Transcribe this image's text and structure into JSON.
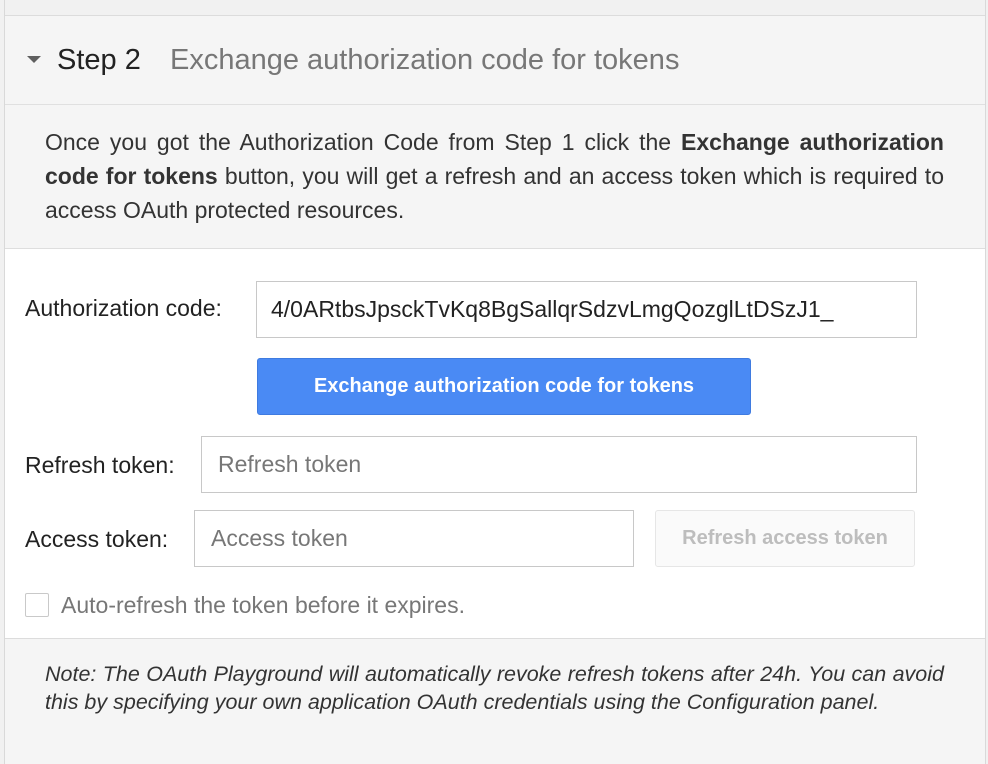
{
  "header": {
    "step_label": "Step 2",
    "step_title": "Exchange authorization code for tokens"
  },
  "description": {
    "text_before": "Once you got the Authorization Code from Step 1 click the ",
    "bold_text": "Exchange authorization code for tokens",
    "text_after": " button, you will get a refresh and an access token which is required to access OAuth protected resources."
  },
  "form": {
    "auth_code_label": "Authorization code:",
    "auth_code_value": "4/0ARtbsJpsckTvKq8BgSallqrSdzvLmgQozglLtDSzJ1_",
    "exchange_button_label": "Exchange authorization code for tokens",
    "refresh_token_label": "Refresh token:",
    "refresh_token_placeholder": "Refresh token",
    "access_token_label": "Access token:",
    "access_token_placeholder": "Access token",
    "refresh_access_button_label": "Refresh access token",
    "auto_refresh_label": "Auto-refresh the token before it expires.",
    "auto_refresh_checked": false
  },
  "note": {
    "text": "Note: The OAuth Playground will automatically revoke refresh tokens after 24h. You can avoid this by specifying your own application OAuth credentials using the Configuration panel."
  },
  "colors": {
    "primary_button": "#4a8af4",
    "disabled_text": "#bdbdbd",
    "muted_text": "#777777"
  }
}
